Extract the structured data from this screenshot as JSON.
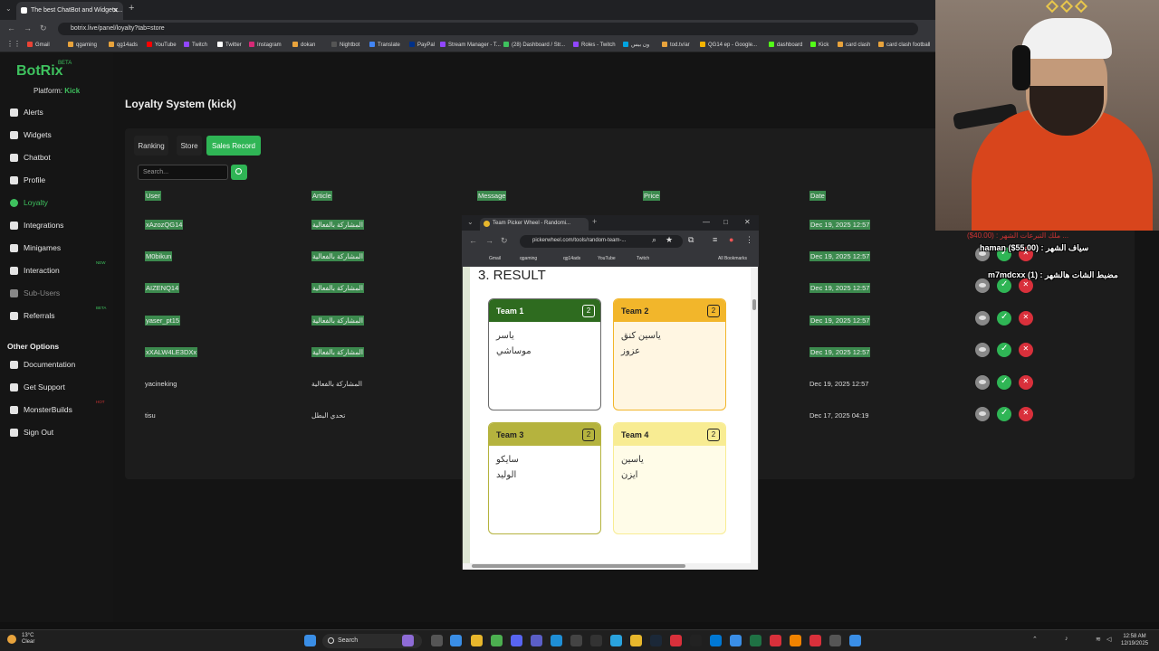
{
  "browser": {
    "tab_title": "The best ChatBot and Widgets...",
    "url": "botrix.live/panel/loyalty?tab=store",
    "bookmarks": [
      {
        "label": "Gmail",
        "color": "#ea4335"
      },
      {
        "label": "qgaming",
        "color": "#e8a33c"
      },
      {
        "label": "qg14ads",
        "color": "#e8a33c"
      },
      {
        "label": "YouTube",
        "color": "#ff0000"
      },
      {
        "label": "Twitch",
        "color": "#9146ff"
      },
      {
        "label": "Twitter",
        "color": "#ffffff"
      },
      {
        "label": "Instagram",
        "color": "#d62976"
      },
      {
        "label": "dokan",
        "color": "#e8a33c"
      },
      {
        "label": "Nightbot",
        "color": "#555555"
      },
      {
        "label": "Translate",
        "color": "#4285f4"
      },
      {
        "label": "PayPal",
        "color": "#003087"
      },
      {
        "label": "Stream Manager - T...",
        "color": "#9146ff"
      },
      {
        "label": "(28) Dashboard / Str...",
        "color": "#3ec15e"
      },
      {
        "label": "Roles - Twitch",
        "color": "#9146ff"
      },
      {
        "label": "ون بيس",
        "color": "#00a3e0"
      },
      {
        "label": "tod.tv/ar",
        "color": "#e8a33c"
      },
      {
        "label": "QG14 ep - Google...",
        "color": "#f4b400"
      },
      {
        "label": "dashboard",
        "color": "#53fc18"
      },
      {
        "label": "Kick",
        "color": "#53fc18"
      },
      {
        "label": "card clash",
        "color": "#e8a33c"
      },
      {
        "label": "card clash football",
        "color": "#e8a33c"
      }
    ]
  },
  "sidebar": {
    "logo": "BotRix",
    "beta": "BETA",
    "platform_label": "Platform:",
    "platform_value": "Kick",
    "items": [
      {
        "label": "Alerts"
      },
      {
        "label": "Widgets"
      },
      {
        "label": "Chatbot"
      },
      {
        "label": "Profile"
      },
      {
        "label": "Loyalty"
      },
      {
        "label": "Integrations"
      },
      {
        "label": "Minigames"
      },
      {
        "label": "Interaction",
        "tag": "NEW"
      },
      {
        "label": "Sub-Users"
      },
      {
        "label": "Referrals",
        "tag": "BETA"
      }
    ],
    "other_heading": "Other Options",
    "other_items": [
      {
        "label": "Documentation"
      },
      {
        "label": "Get Support"
      },
      {
        "label": "MonsterBuilds",
        "tag": "HOT"
      },
      {
        "label": "Sign Out"
      }
    ]
  },
  "main": {
    "title": "Loyalty System (kick)",
    "tabs": [
      "Ranking",
      "Store",
      "Sales Record"
    ],
    "active_tab": "Sales Record",
    "search_placeholder": "Search...",
    "columns": [
      "User",
      "Article",
      "Message",
      "Price",
      "Date"
    ],
    "rows": [
      {
        "user": "xAzozQG14",
        "article": "المشاركة بالفعالية",
        "date": "Dec 19, 2025 12:57",
        "selected": true
      },
      {
        "user": "M0bikun",
        "article": "المشاركة بالفعالية",
        "date": "Dec 19, 2025 12:57",
        "selected": true
      },
      {
        "user": "AIZENQ14",
        "article": "المشاركة بالفعالية",
        "date": "Dec 19, 2025 12:57",
        "selected": true
      },
      {
        "user": "yaser_pt15",
        "article": "المشاركة بالفعالية",
        "date": "Dec 19, 2025 12:57",
        "selected": true
      },
      {
        "user": "xXALW4LE3DXx",
        "article": "المشاركة بالفعالية",
        "date": "Dec 19, 2025 12:57",
        "selected": true
      },
      {
        "user": "yacineking",
        "article": "المشاركة بالفعالية",
        "date": "Dec 19, 2025 12:57",
        "selected": false
      },
      {
        "user": "tisu",
        "article": "تحدي البطل",
        "date": "Dec 17, 2025 04:19",
        "selected": false
      }
    ]
  },
  "popup": {
    "tab_title": "Team Picker Wheel - Randomi...",
    "url": "pickerwheel.com/tools/random-team-...",
    "bookmarks": [
      "Gmail",
      "qgaming",
      "qg14ads",
      "YouTube",
      "Twitch"
    ],
    "all_bookmarks": "All Bookmarks",
    "result_heading": "3. RESULT",
    "teams": [
      {
        "name": "Team 1",
        "count": "2",
        "members": [
          "ياسر",
          "موساشي"
        ],
        "head_color": "#2e6b1f",
        "head_text": "#ffffff",
        "body_color": "#ffffff",
        "border": "#6a6a6a"
      },
      {
        "name": "Team 2",
        "count": "2",
        "members": [
          "ياسين كنق",
          "عزوز"
        ],
        "head_color": "#f2b62b",
        "head_text": "#222222",
        "body_color": "#fff6e2",
        "border": "#f2b62b"
      },
      {
        "name": "Team 3",
        "count": "2",
        "members": [
          "سايكو",
          "الوليد"
        ],
        "head_color": "#b5b33e",
        "head_text": "#222222",
        "body_color": "#ffffff",
        "border": "#b5b33e"
      },
      {
        "name": "Team 4",
        "count": "2",
        "members": [
          "ياسين",
          "ايزن"
        ],
        "head_color": "#f8ec93",
        "head_text": "#222222",
        "body_color": "#fffce8",
        "border": "#f8ec93"
      }
    ]
  },
  "stream_overlay": {
    "line1": "ملك التبرعات الشهر : (40.00$) ...",
    "line2": "haman ($55.00) : سياف الشهر",
    "line3": "m7mdcxx (1) : مضبط الشات هالشهر"
  },
  "taskbar": {
    "temp": "13°C",
    "weather": "Clear",
    "search": "Search",
    "time": "12:58 AM",
    "date": "12/19/2025"
  },
  "colors": {
    "accent": "#2fb555",
    "selection": "#3c8a4e",
    "danger": "#d9303b"
  }
}
